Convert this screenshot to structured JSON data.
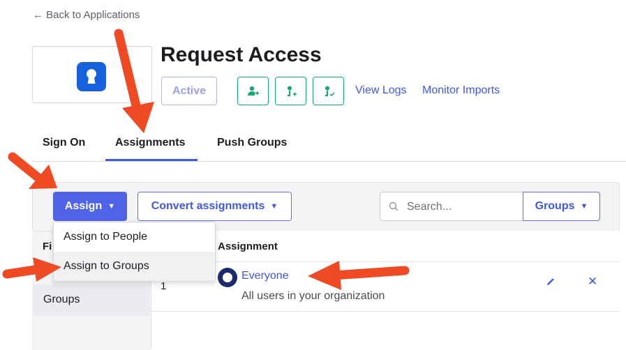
{
  "header": {
    "back_link": "← Back to Applications",
    "app_title": "Request Access",
    "status": "Active",
    "links": [
      "View Logs",
      "Monitor Imports"
    ],
    "icon_buttons": [
      "push-user-icon",
      "assign-user-icon",
      "verify-user-icon"
    ]
  },
  "tabs": [
    {
      "label": "Sign On",
      "active": false
    },
    {
      "label": "Assignments",
      "active": true
    },
    {
      "label": "Push Groups",
      "active": false
    }
  ],
  "toolbar": {
    "assign_label": "Assign",
    "convert_label": "Convert assignments",
    "search_placeholder": "Search...",
    "filter_select": "Groups"
  },
  "assign_menu": {
    "items": [
      "Assign to People",
      "Assign to Groups"
    ],
    "hovered": "Assign to Groups"
  },
  "filters": {
    "header_partial": "Fi",
    "items": [
      "Groups"
    ]
  },
  "table": {
    "header": "Assignment",
    "rows": [
      {
        "priority": "1",
        "name": "Everyone",
        "description": "All users in your organization"
      }
    ]
  },
  "colors": {
    "primary": "#4f63e7",
    "link": "#3f59e4",
    "icon_button": "#1aa37a",
    "logo": "#1662dd",
    "annotation_arrow": "#ee4b24"
  }
}
